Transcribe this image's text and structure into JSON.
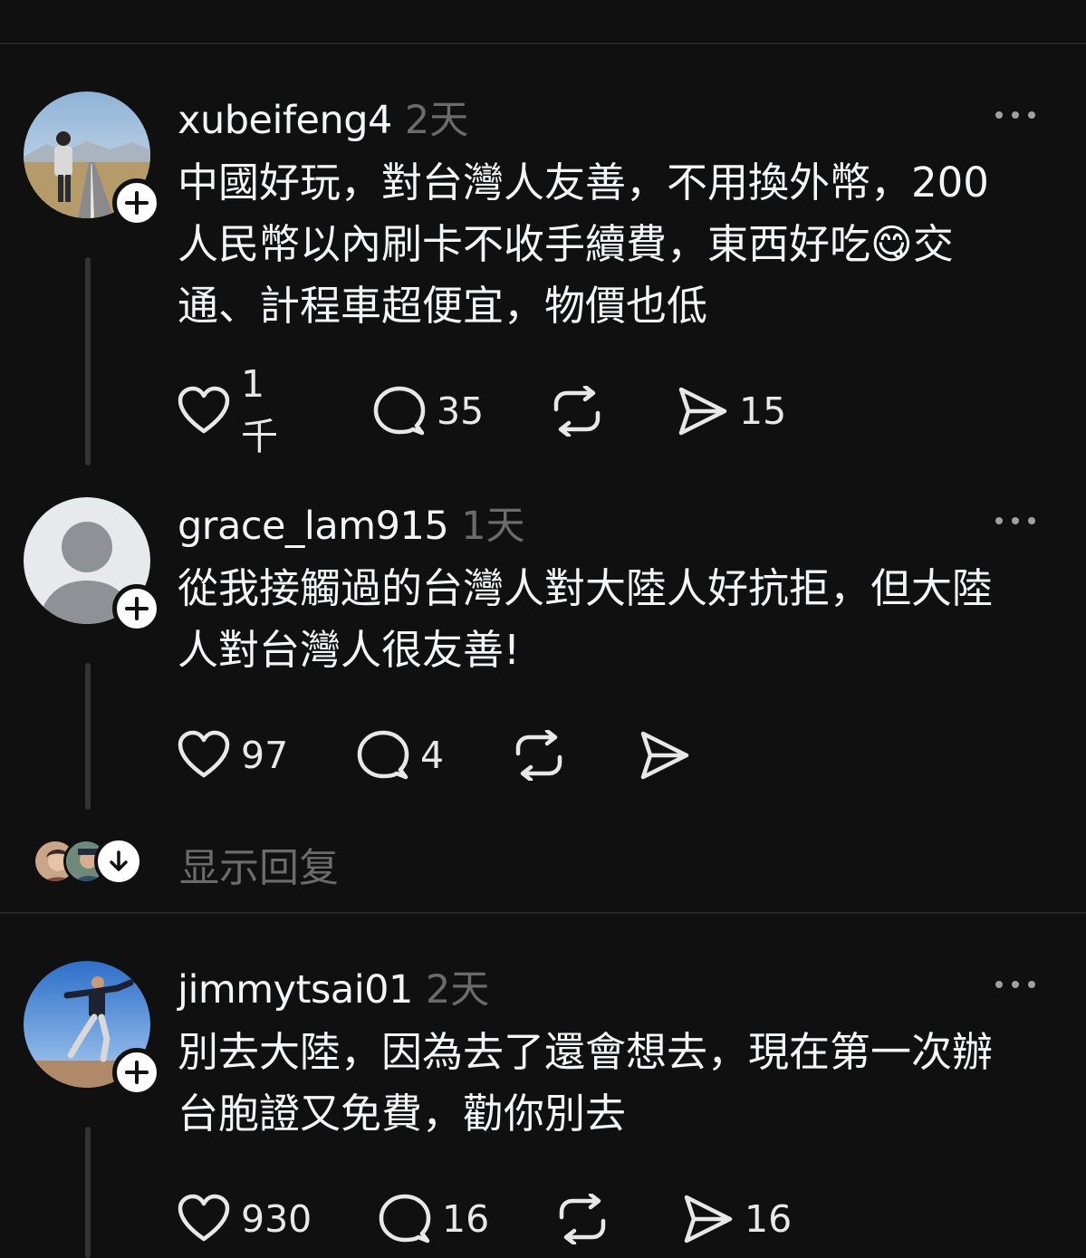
{
  "posts": [
    {
      "username": "xubeifeng4",
      "time": "2天",
      "text": "中國好玩，對台灣人友善，不用換外幣，200\n人民幣以內刷卡不收手續費，東西好吃😋交\n通、計程車超便宜，物價也低",
      "likes": "1千",
      "comments": "35",
      "reposts": "",
      "shares": "15",
      "avatar": "photo-person-road"
    },
    {
      "username": "grace_lam915",
      "time": "1天",
      "text": "從我接觸過的台灣人對大陸人好抗拒，但大陸\n人對台灣人很友善!",
      "likes": "97",
      "comments": "4",
      "reposts": "",
      "shares": "",
      "avatar": "default-avatar",
      "show_replies": "显示回复"
    },
    {
      "username": "jimmytsai01",
      "time": "2天",
      "text": "別去大陸，因為去了還會想去，現在第一次辦\n台胞證又免費，勸你別去",
      "likes": "930",
      "comments": "16",
      "reposts": "",
      "shares": "16",
      "avatar": "photo-person-jumping"
    }
  ],
  "icons": {
    "like": "heart-icon",
    "comment": "comment-bubble-icon",
    "repost": "repost-icon",
    "share": "send-icon",
    "more": "more-dots-icon",
    "follow": "plus-icon",
    "expand": "arrow-down-icon"
  },
  "colors": {
    "background": "#101010",
    "text": "#f3f5f7",
    "muted": "#6b6b6b",
    "divider": "#262626"
  }
}
